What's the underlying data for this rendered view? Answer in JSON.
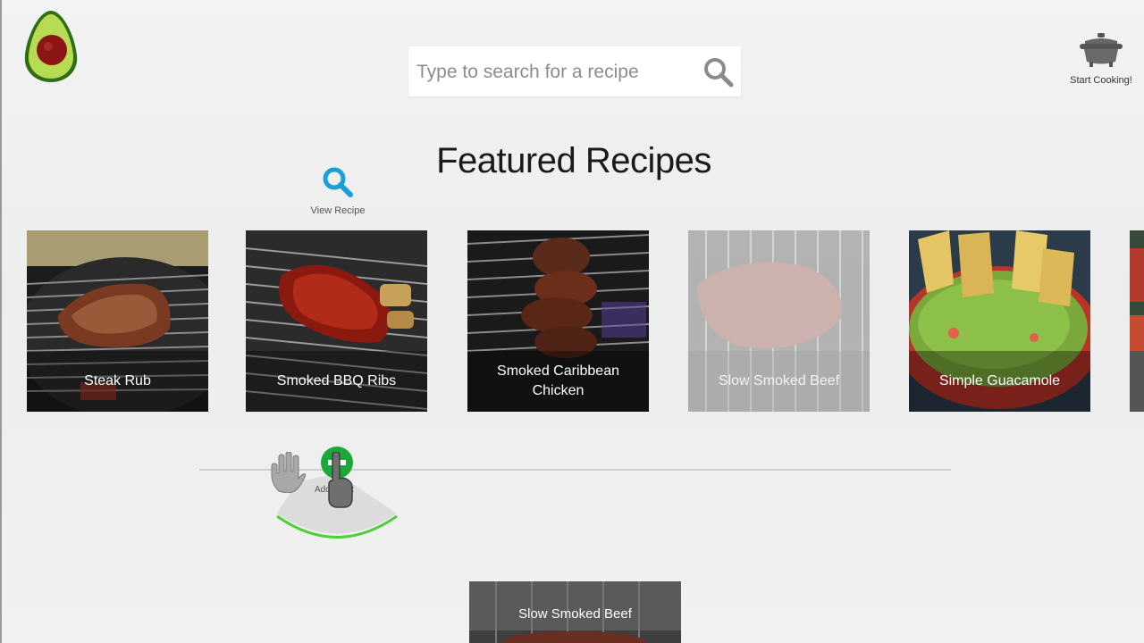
{
  "search": {
    "placeholder": "Type to search for a recipe"
  },
  "header": {
    "start_cooking_label": "Start Cooking!"
  },
  "main": {
    "title": "Featured Recipes"
  },
  "view_recipe": {
    "label": "View Recipe"
  },
  "recipes": [
    {
      "title": "Steak Rub"
    },
    {
      "title": "Smoked BBQ Ribs"
    },
    {
      "title": "Smoked Caribbean Chicken"
    },
    {
      "title": "Slow Smoked Beef"
    },
    {
      "title": "Simple Guacamole"
    }
  ],
  "add_to_list": {
    "label": "Add to list"
  },
  "dragging_card": {
    "title": "Slow Smoked Beef"
  },
  "colors": {
    "accent_blue": "#1a9fd6",
    "add_green": "#1aa83a",
    "arc_green": "#4fd03a"
  }
}
